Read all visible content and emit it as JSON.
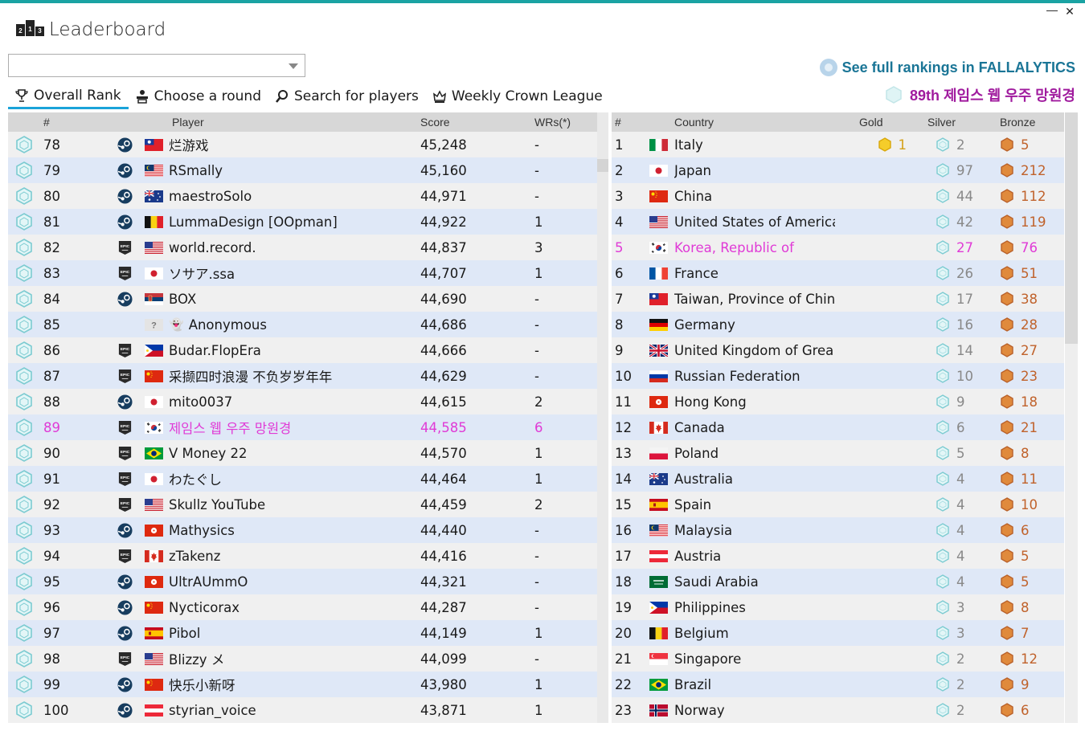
{
  "window": {
    "title": "Leaderboard",
    "minimize_glyph": "—",
    "close_glyph": "✕"
  },
  "dropdown": {
    "value": ""
  },
  "tabs": [
    {
      "label": "Overall Rank",
      "icon": "trophy-icon",
      "active": true
    },
    {
      "label": "Choose a round",
      "icon": "podium-icon",
      "active": false
    },
    {
      "label": "Search for players",
      "icon": "magnifier-icon",
      "active": false
    },
    {
      "label": "Weekly Crown League",
      "icon": "crown-icon",
      "active": false
    }
  ],
  "link_full_rankings": "See full rankings in FALLALYTICS",
  "current_player_line": "89th 제임스 웹 우주 망원경",
  "players_table": {
    "headers": {
      "rank": "#",
      "player": "Player",
      "score": "Score",
      "wrs": "WRs(*)"
    },
    "rows": [
      {
        "rank": "78",
        "platform": "steam",
        "flag": "tw",
        "player": "烂游戏",
        "score": "45,248",
        "wrs": "-"
      },
      {
        "rank": "79",
        "platform": "steam",
        "flag": "my",
        "player": "RSmally",
        "score": "45,160",
        "wrs": "-"
      },
      {
        "rank": "80",
        "platform": "steam",
        "flag": "au",
        "player": "maestroSolo",
        "score": "44,971",
        "wrs": "-"
      },
      {
        "rank": "81",
        "platform": "steam",
        "flag": "be",
        "player": "LummaDesign [OOpman]",
        "score": "44,922",
        "wrs": "1"
      },
      {
        "rank": "82",
        "platform": "epic",
        "flag": "us",
        "player": "world.record.",
        "score": "44,837",
        "wrs": "3"
      },
      {
        "rank": "83",
        "platform": "epic",
        "flag": "jp",
        "player": "ソサア.ssa",
        "score": "44,707",
        "wrs": "1"
      },
      {
        "rank": "84",
        "platform": "steam",
        "flag": "rs",
        "player": "BOX",
        "score": "44,690",
        "wrs": "-"
      },
      {
        "rank": "85",
        "platform": "none",
        "flag": "unknown",
        "player": "Anonymous",
        "score": "44,686",
        "wrs": "-",
        "anonymous": true
      },
      {
        "rank": "86",
        "platform": "epic",
        "flag": "ph",
        "player": "Budar.FlopEra",
        "score": "44,666",
        "wrs": "-"
      },
      {
        "rank": "87",
        "platform": "epic",
        "flag": "cn",
        "player": "采撷四时浪漫 不负岁岁年年",
        "score": "44,629",
        "wrs": "-"
      },
      {
        "rank": "88",
        "platform": "steam",
        "flag": "jp",
        "player": "mito0037",
        "score": "44,615",
        "wrs": "2"
      },
      {
        "rank": "89",
        "platform": "epic",
        "flag": "kr",
        "player": "제임스 웹 우주 망원경",
        "score": "44,585",
        "wrs": "6",
        "me": true
      },
      {
        "rank": "90",
        "platform": "epic",
        "flag": "br",
        "player": "V Money 22",
        "score": "44,570",
        "wrs": "1"
      },
      {
        "rank": "91",
        "platform": "epic",
        "flag": "jp",
        "player": "わたぐし",
        "score": "44,464",
        "wrs": "1"
      },
      {
        "rank": "92",
        "platform": "epic",
        "flag": "us",
        "player": "Skullz YouTube",
        "score": "44,459",
        "wrs": "2"
      },
      {
        "rank": "93",
        "platform": "steam",
        "flag": "hk",
        "player": "Mathysics",
        "score": "44,440",
        "wrs": "-"
      },
      {
        "rank": "94",
        "platform": "epic",
        "flag": "ca",
        "player": "zTakenz",
        "score": "44,416",
        "wrs": "-"
      },
      {
        "rank": "95",
        "platform": "steam",
        "flag": "hk",
        "player": "UltrAUmmO",
        "score": "44,321",
        "wrs": "-"
      },
      {
        "rank": "96",
        "platform": "steam",
        "flag": "cn",
        "player": "Nycticorax",
        "score": "44,287",
        "wrs": "-"
      },
      {
        "rank": "97",
        "platform": "steam",
        "flag": "es",
        "player": "Pibol",
        "score": "44,149",
        "wrs": "1"
      },
      {
        "rank": "98",
        "platform": "epic",
        "flag": "us",
        "player": "Blizzy メ",
        "score": "44,099",
        "wrs": "-"
      },
      {
        "rank": "99",
        "platform": "steam",
        "flag": "cn",
        "player": "快乐小新呀",
        "score": "43,980",
        "wrs": "1"
      },
      {
        "rank": "100",
        "platform": "steam",
        "flag": "at",
        "player": "styrian_voice",
        "score": "43,871",
        "wrs": "1"
      }
    ]
  },
  "countries_table": {
    "headers": {
      "rank": "#",
      "country": "Country",
      "gold": "Gold",
      "silver": "Silver",
      "bronze": "Bronze"
    },
    "rows": [
      {
        "rank": "1",
        "flag": "it",
        "country": "Italy",
        "gold": "1",
        "silver": "2",
        "bronze": "5"
      },
      {
        "rank": "2",
        "flag": "jp",
        "country": "Japan",
        "gold": "",
        "silver": "97",
        "bronze": "212"
      },
      {
        "rank": "3",
        "flag": "cn",
        "country": "China",
        "gold": "",
        "silver": "44",
        "bronze": "112"
      },
      {
        "rank": "4",
        "flag": "us",
        "country": "United States of America",
        "gold": "",
        "silver": "42",
        "bronze": "119"
      },
      {
        "rank": "5",
        "flag": "kr",
        "country": "Korea, Republic of",
        "gold": "",
        "silver": "27",
        "bronze": "76",
        "me": true
      },
      {
        "rank": "6",
        "flag": "fr",
        "country": "France",
        "gold": "",
        "silver": "26",
        "bronze": "51"
      },
      {
        "rank": "7",
        "flag": "tw",
        "country": "Taiwan, Province of China",
        "gold": "",
        "silver": "17",
        "bronze": "38"
      },
      {
        "rank": "8",
        "flag": "de",
        "country": "Germany",
        "gold": "",
        "silver": "16",
        "bronze": "28"
      },
      {
        "rank": "9",
        "flag": "gb",
        "country": "United Kingdom of Grea...",
        "gold": "",
        "silver": "14",
        "bronze": "27"
      },
      {
        "rank": "10",
        "flag": "ru",
        "country": "Russian Federation",
        "gold": "",
        "silver": "10",
        "bronze": "23"
      },
      {
        "rank": "11",
        "flag": "hk",
        "country": "Hong Kong",
        "gold": "",
        "silver": "9",
        "bronze": "18"
      },
      {
        "rank": "12",
        "flag": "ca",
        "country": "Canada",
        "gold": "",
        "silver": "6",
        "bronze": "21"
      },
      {
        "rank": "13",
        "flag": "pl",
        "country": "Poland",
        "gold": "",
        "silver": "5",
        "bronze": "8"
      },
      {
        "rank": "14",
        "flag": "au",
        "country": "Australia",
        "gold": "",
        "silver": "4",
        "bronze": "11"
      },
      {
        "rank": "15",
        "flag": "es",
        "country": "Spain",
        "gold": "",
        "silver": "4",
        "bronze": "10"
      },
      {
        "rank": "16",
        "flag": "my",
        "country": "Malaysia",
        "gold": "",
        "silver": "4",
        "bronze": "6"
      },
      {
        "rank": "17",
        "flag": "at",
        "country": "Austria",
        "gold": "",
        "silver": "4",
        "bronze": "5"
      },
      {
        "rank": "18",
        "flag": "sa",
        "country": "Saudi Arabia",
        "gold": "",
        "silver": "4",
        "bronze": "5"
      },
      {
        "rank": "19",
        "flag": "ph",
        "country": "Philippines",
        "gold": "",
        "silver": "3",
        "bronze": "8"
      },
      {
        "rank": "20",
        "flag": "be",
        "country": "Belgium",
        "gold": "",
        "silver": "3",
        "bronze": "7"
      },
      {
        "rank": "21",
        "flag": "sg",
        "country": "Singapore",
        "gold": "",
        "silver": "2",
        "bronze": "12"
      },
      {
        "rank": "22",
        "flag": "br",
        "country": "Brazil",
        "gold": "",
        "silver": "2",
        "bronze": "9"
      },
      {
        "rank": "23",
        "flag": "no",
        "country": "Norway",
        "gold": "",
        "silver": "2",
        "bronze": "6"
      }
    ]
  },
  "colors": {
    "accent": "#1aa3d9",
    "highlight": "#e03ad6",
    "link": "#1a7596",
    "me_line": "#a01b9e",
    "gold": "#d4a017",
    "bronze": "#c0622b"
  }
}
